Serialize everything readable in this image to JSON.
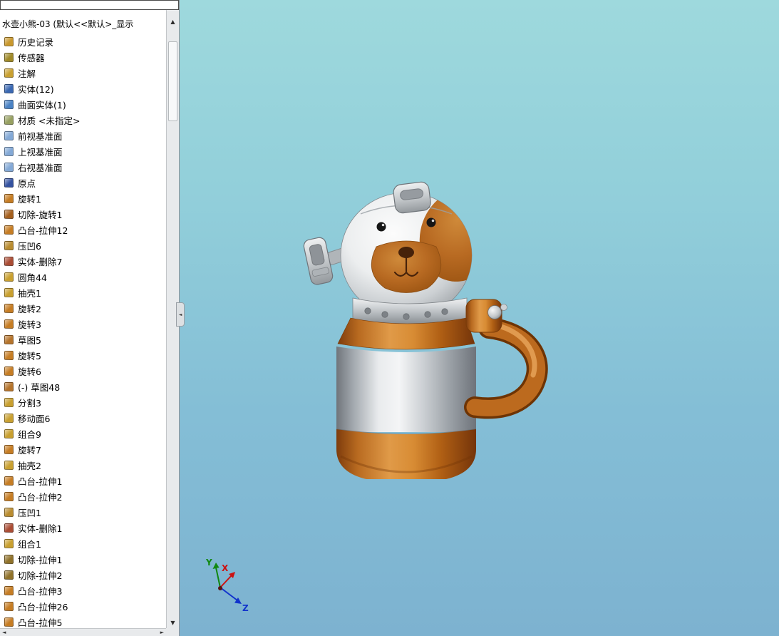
{
  "feature_tree": {
    "title": "水壶小熊-03  (默认<<默认>_显示",
    "scroll_up": "▲",
    "scroll_down": "▼",
    "scroll_left": "◄",
    "scroll_right": "►",
    "collapse_arrow": "◄",
    "items": [
      {
        "label": "历史记录",
        "icon": "history-folder-icon",
        "color": "#c9982d"
      },
      {
        "label": "传感器",
        "icon": "sensors-icon",
        "color": "#a08a28"
      },
      {
        "label": "注解",
        "icon": "annotations-icon",
        "color": "#c9a030"
      },
      {
        "label": "实体(12)",
        "icon": "solid-bodies-folder-icon",
        "color": "#3a68b2"
      },
      {
        "label": "曲面实体(1)",
        "icon": "surface-bodies-folder-icon",
        "color": "#4a82c4"
      },
      {
        "label": "材质 <未指定>",
        "icon": "material-icon",
        "color": "#97a061"
      },
      {
        "label": "前视基准面",
        "icon": "front-plane-icon",
        "color": "#84a9d6"
      },
      {
        "label": "上视基准面",
        "icon": "top-plane-icon",
        "color": "#84a9d6"
      },
      {
        "label": "右视基准面",
        "icon": "right-plane-icon",
        "color": "#84a9d6"
      },
      {
        "label": "原点",
        "icon": "origin-icon",
        "color": "#3452a0"
      },
      {
        "label": "旋转1",
        "icon": "revolve-icon",
        "color": "#c67d24"
      },
      {
        "label": "切除-旋转1",
        "icon": "cut-revolve-icon",
        "color": "#a5601e"
      },
      {
        "label": "凸台-拉伸12",
        "icon": "boss-extrude-icon",
        "color": "#c67d24"
      },
      {
        "label": "压凹6",
        "icon": "indent-icon",
        "color": "#b98c30"
      },
      {
        "label": "实体-删除7",
        "icon": "body-delete-icon",
        "color": "#aa4c34"
      },
      {
        "label": "圆角44",
        "icon": "fillet-icon",
        "color": "#c9a030"
      },
      {
        "label": "抽壳1",
        "icon": "shell-icon",
        "color": "#c9a030"
      },
      {
        "label": "旋转2",
        "icon": "revolve-icon",
        "color": "#c67d24"
      },
      {
        "label": "旋转3",
        "icon": "revolve-icon",
        "color": "#c67d24"
      },
      {
        "label": "草图5",
        "icon": "sketch-icon",
        "color": "#b5742c"
      },
      {
        "label": "旋转5",
        "icon": "revolve-icon",
        "color": "#c67d24"
      },
      {
        "label": "旋转6",
        "icon": "revolve-icon",
        "color": "#c67d24"
      },
      {
        "label": "(-) 草图48",
        "icon": "sketch-icon",
        "color": "#b5742c"
      },
      {
        "label": "分割3",
        "icon": "split-icon",
        "color": "#c9a030"
      },
      {
        "label": "移动面6",
        "icon": "move-face-icon",
        "color": "#c9a030"
      },
      {
        "label": "组合9",
        "icon": "combine-icon",
        "color": "#c9a030"
      },
      {
        "label": "旋转7",
        "icon": "revolve-icon",
        "color": "#c67d24"
      },
      {
        "label": "抽壳2",
        "icon": "shell-icon",
        "color": "#c9a030"
      },
      {
        "label": "凸台-拉伸1",
        "icon": "boss-extrude-icon",
        "color": "#c67d24"
      },
      {
        "label": "凸台-拉伸2",
        "icon": "boss-extrude-icon",
        "color": "#c67d24"
      },
      {
        "label": "压凹1",
        "icon": "indent-icon",
        "color": "#b98c30"
      },
      {
        "label": "实体-删除1",
        "icon": "body-delete-icon",
        "color": "#aa4c34"
      },
      {
        "label": "组合1",
        "icon": "combine-icon",
        "color": "#c9a030"
      },
      {
        "label": "切除-拉伸1",
        "icon": "cut-extrude-icon",
        "color": "#90722a"
      },
      {
        "label": "切除-拉伸2",
        "icon": "cut-extrude-icon",
        "color": "#90722a"
      },
      {
        "label": "凸台-拉伸3",
        "icon": "boss-extrude-icon",
        "color": "#c67d24"
      },
      {
        "label": "凸台-拉伸26",
        "icon": "boss-extrude-icon",
        "color": "#c67d24"
      },
      {
        "label": "凸台-拉伸5",
        "icon": "boss-extrude-icon",
        "color": "#c67d24"
      }
    ]
  },
  "viewport": {
    "triad": {
      "x": "X",
      "y": "Y",
      "z": "Z"
    },
    "colors": {
      "background_top": "#9ed9dd",
      "background_bottom": "#7db2d0",
      "body_silver": "#cfd3d6",
      "accent_orange": "#c87c2c",
      "face_patch": "#b86a22",
      "triad_x": "#cc1111",
      "triad_y": "#118811",
      "triad_z": "#1133cc"
    }
  }
}
